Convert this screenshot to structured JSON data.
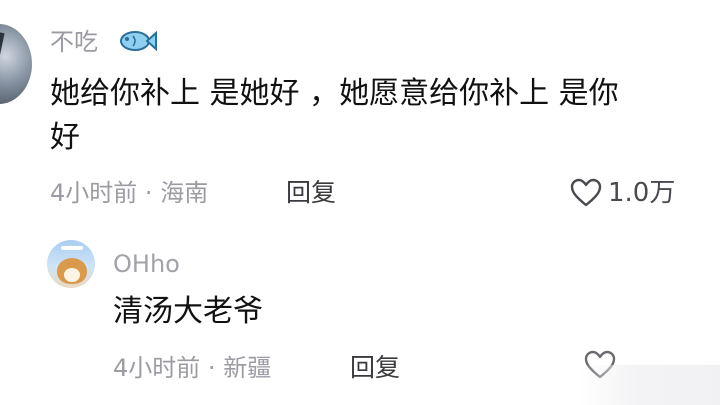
{
  "comment": {
    "username": "不吃",
    "badge_icon": "fish-icon",
    "text_line1": "她给你补上 是她好 ，她愿意给你补上 是你",
    "text_line2": "好",
    "time": "4小时前",
    "separator": "·",
    "location": "海南",
    "reply_label": "回复",
    "like_count": "1.0万"
  },
  "reply": {
    "username": "OHho",
    "text": "清汤大老爷",
    "time": "4小时前",
    "separator": "·",
    "location": "新疆",
    "reply_label": "回复"
  }
}
